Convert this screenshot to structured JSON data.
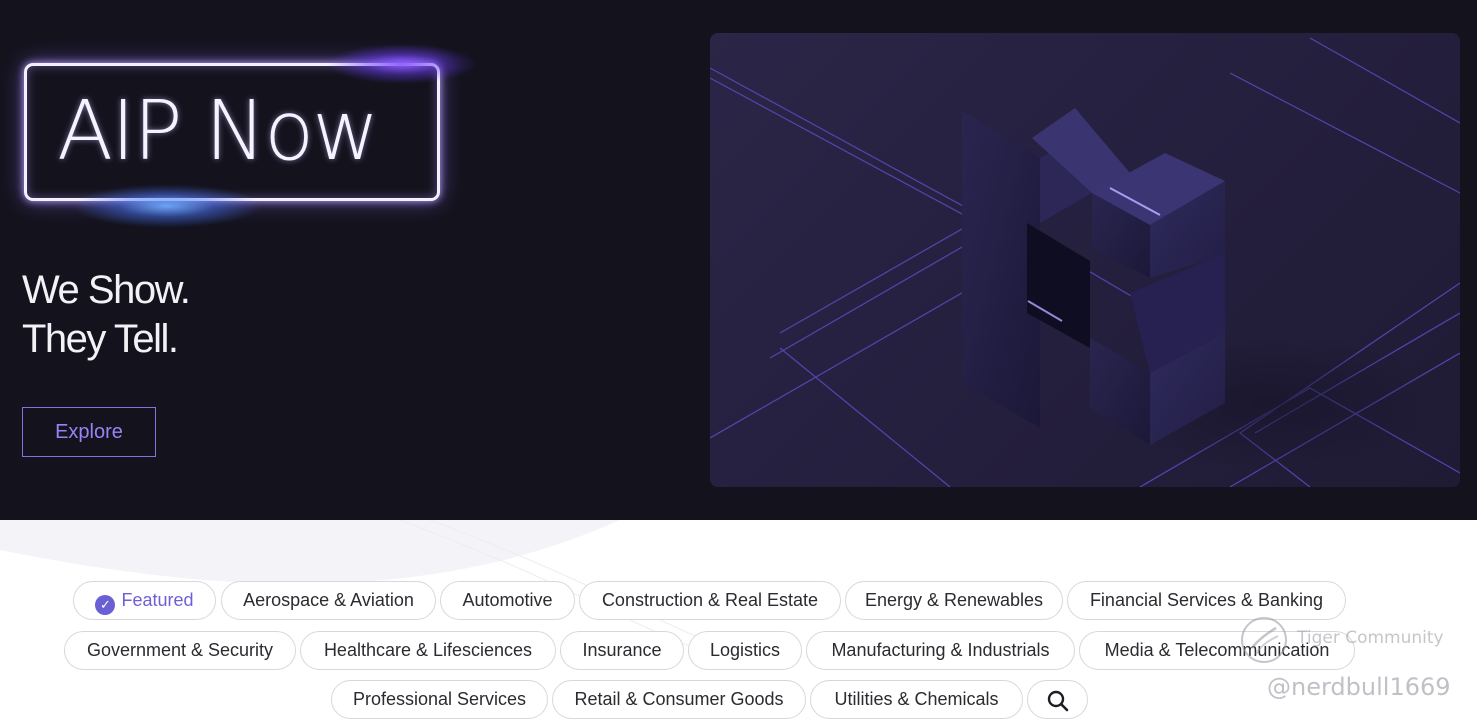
{
  "hero": {
    "logo_text": "AIP Now",
    "tagline_line1": "We Show.",
    "tagline_line2": "They Tell.",
    "explore_label": "Explore"
  },
  "filters": {
    "featured_label": "Featured",
    "row1": [
      "Aerospace & Aviation",
      "Automotive",
      "Construction & Real Estate",
      "Energy & Renewables",
      "Financial Services & Banking"
    ],
    "row2": [
      "Government & Security",
      "Healthcare & Lifesciences",
      "Insurance",
      "Logistics",
      "Manufacturing & Industrials",
      "Media & Telecommunication"
    ],
    "row3": [
      "Professional Services",
      "Retail & Consumer Goods",
      "Utilities & Chemicals"
    ]
  },
  "watermark": {
    "community": "Tiger Community",
    "user": "@nerdbull1669"
  },
  "colors": {
    "hero_bg": "#14131d",
    "accent": "#6a5fd3",
    "explore_text": "#9a82f5"
  },
  "icons": {
    "featured": "check-badge-icon",
    "search": "search-icon",
    "watermark": "tiger-logo-icon"
  }
}
